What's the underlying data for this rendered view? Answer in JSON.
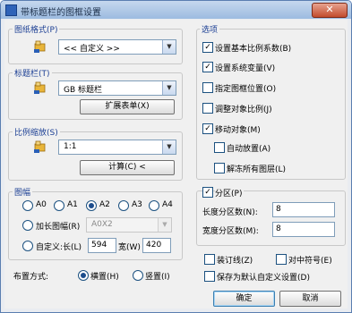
{
  "window": {
    "title": "带标题栏的图框设置",
    "close_label": "✕"
  },
  "frame_format": {
    "legend": "图纸格式(P)",
    "value": "<< 自定义 >>"
  },
  "title_block": {
    "legend": "标题栏(T)",
    "value": "GB 标题栏",
    "expand_button": "扩展表单(X)"
  },
  "scale": {
    "legend": "比例缩放(S)",
    "value": "1:1",
    "calc_button": "计算(C) <"
  },
  "sheet": {
    "legend": "图幅",
    "sizes": [
      {
        "label": "A0",
        "selected": false
      },
      {
        "label": "A1",
        "selected": false
      },
      {
        "label": "A2",
        "selected": true
      },
      {
        "label": "A3",
        "selected": false
      },
      {
        "label": "A4",
        "selected": false
      }
    ],
    "extended_label": "加长图幅(R)",
    "extended_value": "A0X2",
    "custom_label": "自定义:长(L)",
    "custom_length": "594",
    "width_label": "宽(W)",
    "custom_width": "420"
  },
  "layout": {
    "label": "布置方式:",
    "horizontal": "横置(H)",
    "vertical": "竖置(I)",
    "selected": "horizontal"
  },
  "options": {
    "legend": "选项",
    "items": [
      {
        "label": "设置基本比例系数(B)",
        "checked": true
      },
      {
        "label": "设置系统变量(V)",
        "checked": true
      },
      {
        "label": "指定图框位置(O)",
        "checked": false
      },
      {
        "label": "调整对象比例(J)",
        "checked": false
      },
      {
        "label": "移动对象(M)",
        "checked": true
      }
    ],
    "sub_items": [
      {
        "label": "自动放置(A)",
        "checked": false
      },
      {
        "label": "解冻所有图层(L)",
        "checked": false
      }
    ]
  },
  "partition": {
    "label": "分区(P)",
    "checked": true,
    "length_label": "长度分区数(N):",
    "length_value": "8",
    "width_label": "宽度分区数(M):",
    "width_value": "8"
  },
  "extras": {
    "binding_line": "装订线(Z)",
    "binding_checked": false,
    "center_mark": "对中符号(E)",
    "center_checked": false,
    "save_default": "保存为默认自定义设置(D)",
    "save_checked": false
  },
  "buttons": {
    "ok": "确定",
    "cancel": "取消"
  },
  "colors": {
    "legend_text": "#1c3f94",
    "title_bar": "#9cbbe0",
    "border": "#5a7eb0"
  }
}
